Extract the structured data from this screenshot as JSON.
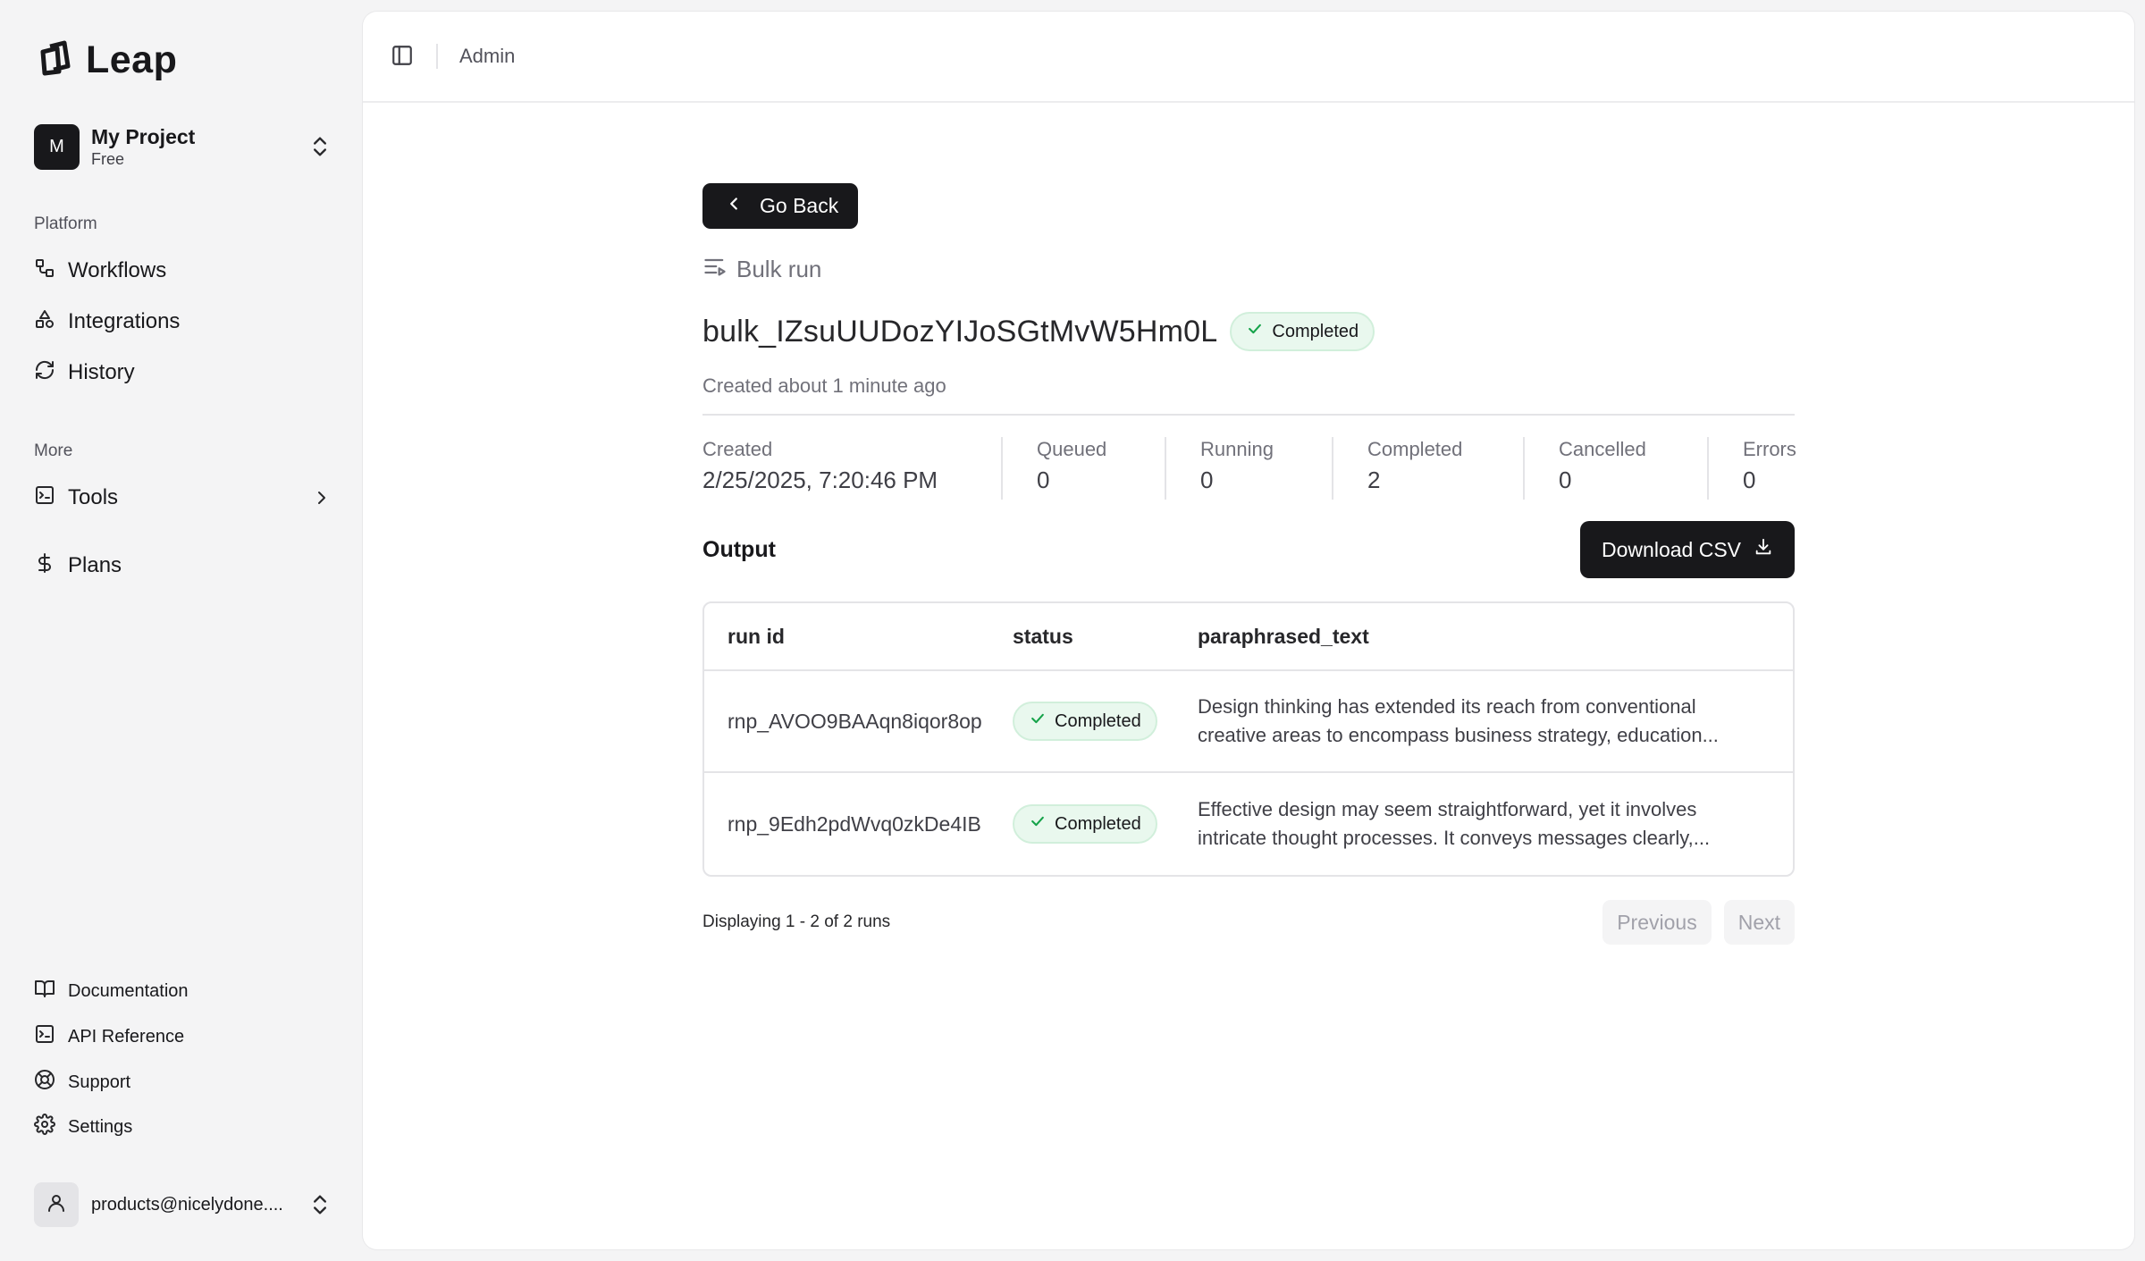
{
  "brand": {
    "name": "Leap"
  },
  "project": {
    "initial": "M",
    "name": "My Project",
    "plan": "Free"
  },
  "sidebar": {
    "platform_label": "Platform",
    "platform_items": [
      {
        "label": "Workflows",
        "icon": "workflow-icon"
      },
      {
        "label": "Integrations",
        "icon": "shapes-icon"
      },
      {
        "label": "History",
        "icon": "refresh-icon"
      }
    ],
    "more_label": "More",
    "more_items": [
      {
        "label": "Tools",
        "icon": "terminal-icon"
      },
      {
        "label": "Plans",
        "icon": "dollar-icon"
      }
    ],
    "footer_items": [
      {
        "label": "Documentation",
        "icon": "book-icon"
      },
      {
        "label": "API Reference",
        "icon": "terminal-icon"
      },
      {
        "label": "Support",
        "icon": "lifebuoy-icon"
      },
      {
        "label": "Settings",
        "icon": "gear-icon"
      }
    ],
    "user_email": "products@nicelydone...."
  },
  "topbar": {
    "title": "Admin"
  },
  "page": {
    "back_label": "Go Back",
    "type_label": "Bulk run",
    "run_id": "bulk_IZsuUUDozYIJoSGtMvW5Hm0L",
    "status": "Completed",
    "created_ago": "Created about 1 minute ago",
    "stats": [
      {
        "label": "Created",
        "value": "2/25/2025, 7:20:46 PM"
      },
      {
        "label": "Queued",
        "value": "0"
      },
      {
        "label": "Running",
        "value": "0"
      },
      {
        "label": "Completed",
        "value": "2"
      },
      {
        "label": "Cancelled",
        "value": "0"
      },
      {
        "label": "Errors",
        "value": "0"
      }
    ],
    "output_title": "Output",
    "download_label": "Download CSV"
  },
  "table": {
    "headers": [
      "run id",
      "status",
      "paraphrased_text"
    ],
    "rows": [
      {
        "run_id": "rnp_AVOO9BAAqn8iqor8op",
        "status": "Completed",
        "text": "Design thinking has extended its reach from conventional creative areas to encompass business strategy, education..."
      },
      {
        "run_id": "rnp_9Edh2pdWvq0zkDe4IB",
        "status": "Completed",
        "text": "Effective design may seem straightforward, yet it involves intricate thought processes. It conveys messages clearly,..."
      }
    ]
  },
  "pagination": {
    "summary": "Displaying 1 - 2 of 2 runs",
    "prev": "Previous",
    "next": "Next"
  },
  "colors": {
    "accent": "#18181b",
    "success_bg": "#e9f8ee",
    "success_icon": "#16a34a"
  }
}
